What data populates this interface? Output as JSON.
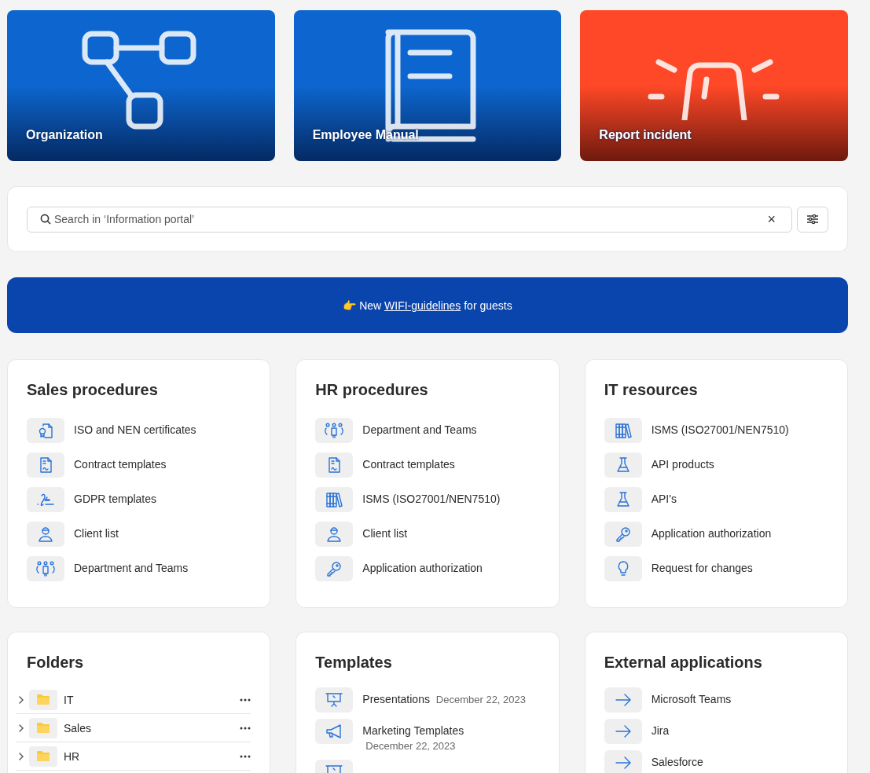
{
  "tiles": [
    {
      "kind": "organization",
      "label": "Organization"
    },
    {
      "kind": "manual",
      "label": "Employee Manual"
    },
    {
      "kind": "alert",
      "label": "Report incident"
    }
  ],
  "search": {
    "placeholder": "Search in ‘Information portal’",
    "clear": "×"
  },
  "banner": {
    "emoji": "👉",
    "before": "New",
    "link": "WIFI-guidelines",
    "after": "for guests"
  },
  "cards": [
    {
      "title": "Sales procedures",
      "items": [
        {
          "kind": "certificate",
          "label": "ISO and NEN certificates"
        },
        {
          "kind": "contract",
          "label": "Contract templates"
        },
        {
          "kind": "signature",
          "label": "GDPR templates"
        },
        {
          "kind": "person",
          "label": "Client list"
        },
        {
          "kind": "team",
          "label": "Department and Teams"
        }
      ]
    },
    {
      "title": "HR procedures",
      "items": [
        {
          "kind": "team",
          "label": "Department and Teams"
        },
        {
          "kind": "contract",
          "label": "Contract templates"
        },
        {
          "kind": "books",
          "label": "ISMS (ISO27001/NEN7510)"
        },
        {
          "kind": "person",
          "label": "Client list"
        },
        {
          "kind": "key",
          "label": "Application authorization"
        }
      ]
    },
    {
      "title": "IT resources",
      "items": [
        {
          "kind": "books",
          "label": "ISMS (ISO27001/NEN7510)"
        },
        {
          "kind": "flask",
          "label": "API products"
        },
        {
          "kind": "flask",
          "label": "API's"
        },
        {
          "kind": "key",
          "label": "Application authorization"
        },
        {
          "kind": "bulb",
          "label": "Request for changes"
        }
      ]
    }
  ],
  "folders": {
    "title": "Folders",
    "items": [
      {
        "name": "IT",
        "expanded": false
      },
      {
        "name": "Sales",
        "expanded": false
      },
      {
        "name": "HR",
        "expanded": false
      }
    ]
  },
  "templates": {
    "title": "Templates",
    "items": [
      {
        "kind": "presentation",
        "label": "Presentations",
        "date": "December 22, 2023"
      },
      {
        "kind": "megaphone",
        "label": "Marketing Templates",
        "date": "December 22, 2023"
      },
      {
        "kind": "presentation"
      }
    ]
  },
  "external": {
    "title": "External applications",
    "items": [
      {
        "kind": "arrow",
        "label": "Microsoft Teams"
      },
      {
        "kind": "arrow",
        "label": "Jira"
      },
      {
        "kind": "arrow",
        "label": "Salesforce"
      }
    ]
  }
}
